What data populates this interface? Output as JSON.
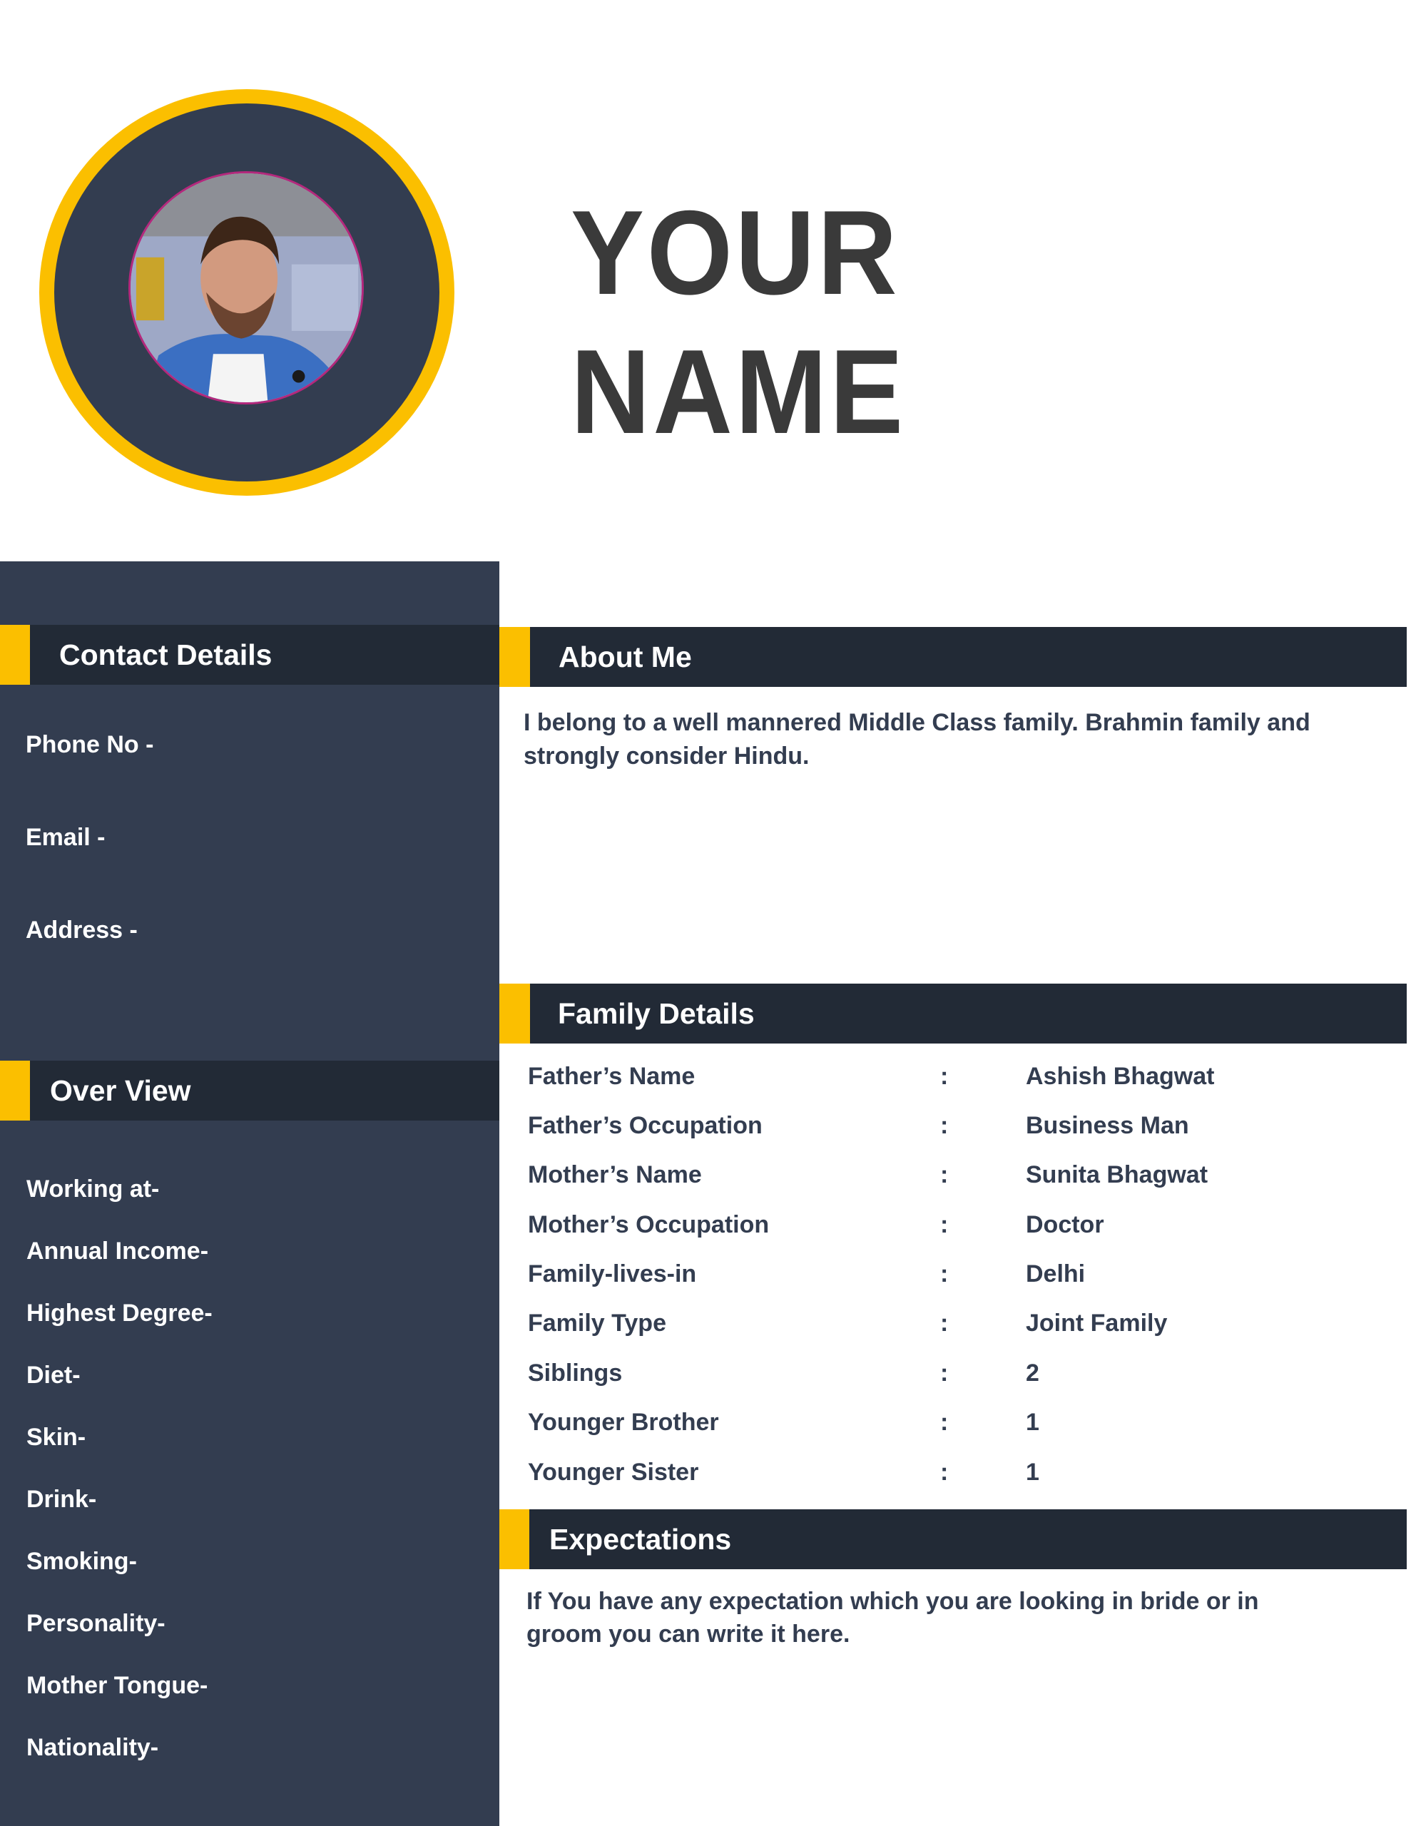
{
  "header": {
    "name_line1": "YOUR",
    "name_line2": "NAME",
    "photo": "profile-photo"
  },
  "colors": {
    "accent": "#fbbf00",
    "sidebar": "#333d50",
    "section_header": "#222a36",
    "name_text": "#3a3a3a",
    "body_text": "#333d50"
  },
  "contact": {
    "title": "Contact Details",
    "items": [
      {
        "label": "Phone No -"
      },
      {
        "label": "Email -"
      },
      {
        "label": "Address -"
      }
    ]
  },
  "overview": {
    "title": "Over View",
    "items": [
      {
        "label": "Working at-"
      },
      {
        "label": "Annual Income-"
      },
      {
        "label": "Highest Degree-"
      },
      {
        "label": "Diet-"
      },
      {
        "label": "Skin-"
      },
      {
        "label": "Drink-"
      },
      {
        "label": "Smoking-"
      },
      {
        "label": "Personality-"
      },
      {
        "label": "Mother Tongue-"
      },
      {
        "label": "Nationality-"
      }
    ]
  },
  "about": {
    "title": "About Me",
    "line1": "I belong to a well mannered Middle Class family. Brahmin family and",
    "line2": "strongly consider Hindu."
  },
  "family": {
    "title": "Family Details",
    "separator": ":",
    "rows": [
      {
        "key": "Father’s Name",
        "value": "Ashish Bhagwat"
      },
      {
        "key": "Father’s Occupation",
        "value": "Business Man"
      },
      {
        "key": "Mother’s Name",
        "value": "Sunita Bhagwat"
      },
      {
        "key": "Mother’s Occupation",
        "value": "Doctor"
      },
      {
        "key": "Family-lives-in",
        "value": "Delhi"
      },
      {
        "key": "Family Type",
        "value": "Joint Family"
      },
      {
        "key": "Siblings",
        "value": "2"
      },
      {
        "key": "Younger Brother",
        "value": "1"
      },
      {
        "key": "Younger Sister",
        "value": "1"
      }
    ]
  },
  "expectations": {
    "title": "Expectations",
    "line1": "If You have any expectation which you are looking in bride or in",
    "line2": "groom you can write it here."
  }
}
